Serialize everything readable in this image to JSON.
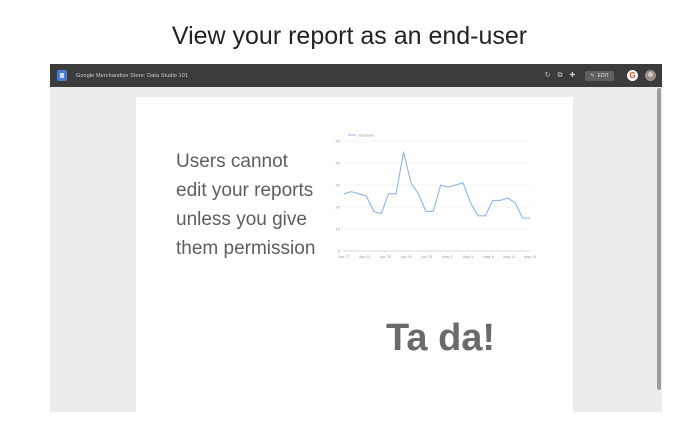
{
  "slide": {
    "title": "View your report as an end-user"
  },
  "window": {
    "app_title": "Google Merchandise Store: Data Studio 101",
    "edit_label": "EDIT",
    "icons": [
      "refresh-icon",
      "copy-icon",
      "share-icon",
      "edit-icon",
      "google-account-icon",
      "avatar"
    ]
  },
  "report": {
    "body_text": "Users cannot edit your reports unless you give them permission",
    "tada": "Ta da!"
  },
  "colors": {
    "line": "#8fb4e3",
    "topbar": "#3b3b3b"
  },
  "chart_data": {
    "type": "line",
    "series": [
      {
        "name": "Sessions",
        "values": [
          26,
          27,
          26,
          25,
          18,
          17,
          26,
          26,
          45,
          31,
          26,
          18,
          18,
          30,
          29,
          30,
          31,
          22,
          16,
          16,
          23,
          23,
          24,
          22,
          15,
          15
        ]
      }
    ],
    "x_ticks": [
      "Apr 17",
      "Apr 20",
      "Apr 23",
      "Apr 26",
      "Apr 29",
      "May 2",
      "May 5",
      "May 8",
      "May 11",
      "May 14"
    ],
    "y_ticks": [
      "50",
      "40",
      "30",
      "20",
      "10",
      "0"
    ],
    "ylim": [
      0,
      50
    ],
    "grid": true,
    "legend": "top-left"
  }
}
